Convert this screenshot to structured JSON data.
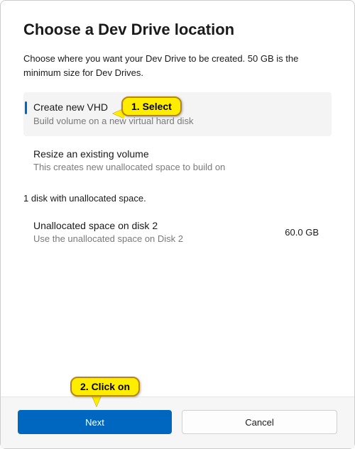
{
  "title": "Choose a Dev Drive location",
  "subtitle": "Choose where you want your Dev Drive to be created. 50 GB is the minimum size for Dev Drives.",
  "options": {
    "create_vhd": {
      "title": "Create new VHD",
      "desc": "Build volume on a new virtual hard disk"
    },
    "resize": {
      "title": "Resize an existing volume",
      "desc": "This creates new unallocated space to build on"
    }
  },
  "section_label": "1 disk with unallocated space.",
  "disk": {
    "title": "Unallocated space on disk 2",
    "desc": "Use the unallocated space on Disk 2",
    "size": "60.0 GB"
  },
  "buttons": {
    "next": "Next",
    "cancel": "Cancel"
  },
  "annotations": {
    "select": "1. Select",
    "click": "2. Click on"
  }
}
